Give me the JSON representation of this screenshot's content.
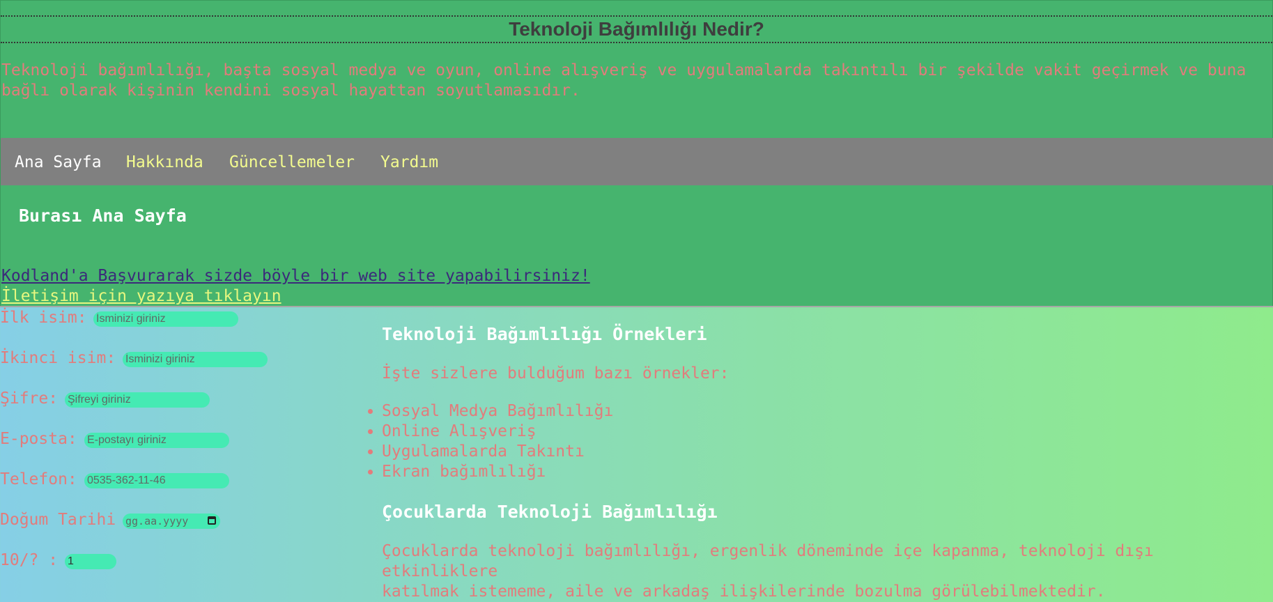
{
  "header": {
    "title": "Teknoloji Bağımlılığı Nedir?",
    "intro_line1": "Teknoloji bağımlılığı, başta sosyal medya ve oyun, online alışveriş ve uygulamalarda takıntılı bir şekilde vakit geçirmek ve buna",
    "intro_line2": "bağlı olarak kişinin kendini sosyal hayattan soyutlamasıdır."
  },
  "nav": {
    "items": [
      {
        "label": "Ana Sayfa"
      },
      {
        "label": "Hakkında"
      },
      {
        "label": "Güncellemeler"
      },
      {
        "label": "Yardım"
      }
    ]
  },
  "page": {
    "heading": "Burası Ana Sayfa",
    "kodland_link": "Kodland'a Başvurarak sizde böyle bir web site yapabilirsiniz!",
    "contact_link": "İletişim için yazıya tıklayın"
  },
  "form": {
    "first_name": {
      "label": "İlk isim:",
      "placeholder": "İsminizi giriniz"
    },
    "second_name": {
      "label": "İkinci isim:",
      "placeholder": "İsminizi giriniz"
    },
    "password": {
      "label": "Şifre:",
      "placeholder": "Şifreyi giriniz"
    },
    "email": {
      "label": "E-posta:",
      "placeholder": "E-postayı giriniz"
    },
    "phone": {
      "label": "Telefon:",
      "placeholder": "0535-362-11-46"
    },
    "birth_date": {
      "label": "Doğum Tarihi",
      "placeholder": "gg.aa.yyyy"
    },
    "rating": {
      "label": "10/? :",
      "value": "1"
    }
  },
  "examples": {
    "heading": "Teknoloji Bağımlılığı Örnekleri",
    "intro": "İşte sizlere bulduğum bazı örnekler:",
    "items": [
      "Sosyal Medya Bağımlılığı",
      "Online Alışveriş",
      "Uygulamalarda Takıntı",
      "Ekran bağımlılığı"
    ]
  },
  "children": {
    "heading": "Çocuklarda Teknoloji Bağımlılığı",
    "text_line1": "Çocuklarda teknoloji bağımlılığı, ergenlik döneminde içe kapanma, teknoloji dışı etkinliklere",
    "text_line2": "katılmak istememe, aile ve arkadaş ilişkilerinde bozulma görülebilmektedir."
  },
  "colors": {
    "header_bg": "#46b46e",
    "nav_bg": "#808080",
    "accent_text": "#e27c7c",
    "input_bg": "#45eab3",
    "nav_link": "#f3fb8f"
  }
}
